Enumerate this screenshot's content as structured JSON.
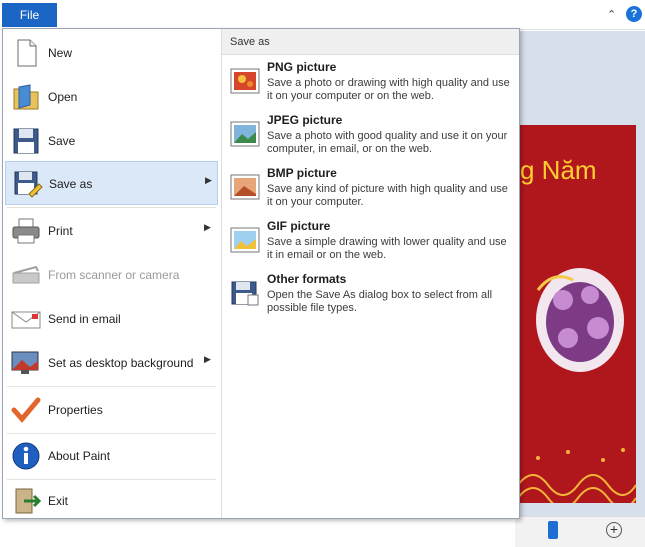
{
  "titlebar": {
    "file_tab": "File",
    "help": "?"
  },
  "canvas": {
    "text": "g Năm"
  },
  "menu": {
    "items": [
      {
        "label": "New"
      },
      {
        "label": "Open"
      },
      {
        "label": "Save"
      },
      {
        "label": "Save as",
        "submenu": true,
        "active": true
      },
      {
        "label": "Print",
        "submenu": true
      },
      {
        "label": "From scanner or camera",
        "disabled": true
      },
      {
        "label": "Send in email"
      },
      {
        "label": "Set as desktop background",
        "submenu": true
      },
      {
        "label": "Properties"
      },
      {
        "label": "About Paint"
      },
      {
        "label": "Exit"
      }
    ]
  },
  "save_as": {
    "header": "Save as",
    "options": [
      {
        "title": "PNG picture",
        "desc": "Save a photo or drawing with high quality and use it on your computer or on the web."
      },
      {
        "title": "JPEG picture",
        "desc": "Save a photo with good quality and use it on your computer, in email, or on the web."
      },
      {
        "title": "BMP picture",
        "desc": "Save any kind of picture with high quality and use it on your computer."
      },
      {
        "title": "GIF picture",
        "desc": "Save a simple drawing with lower quality and use it in email or on the web."
      },
      {
        "title": "Other formats",
        "desc": "Open the Save As dialog box to select from all possible file types."
      }
    ]
  }
}
